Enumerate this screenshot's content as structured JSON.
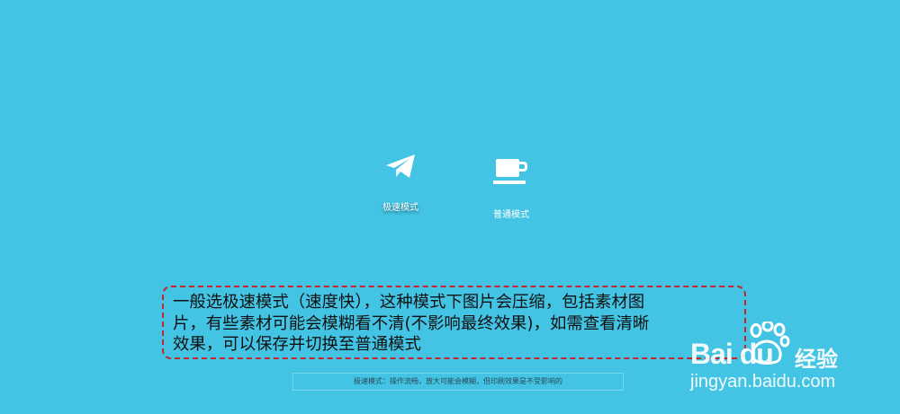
{
  "modes": {
    "fast": {
      "label": "极速模式",
      "icon": "paper-plane-icon",
      "selected": true
    },
    "normal": {
      "label": "普通模式",
      "icon": "coffee-cup-icon",
      "selected": false
    }
  },
  "annotation": {
    "line1": "一般选极速模式（速度快），这种模式下图片会压缩，包括素材图",
    "line2": "片，有些素材可能会模糊看不清(不影响最终效果)，如需查看清晰",
    "line3": "效果，可以保存并切换至普通模式",
    "border_color": "#c8242b"
  },
  "info_bar": {
    "text": "极速模式：操作流畅，放大可能会模糊，但印刷效果是不受影响的"
  },
  "watermark": {
    "brand": "Bai du",
    "product": "经验",
    "url": "jingyan.baidu.com"
  },
  "colors": {
    "background": "#43c4e4",
    "icon": "#ffffff"
  }
}
